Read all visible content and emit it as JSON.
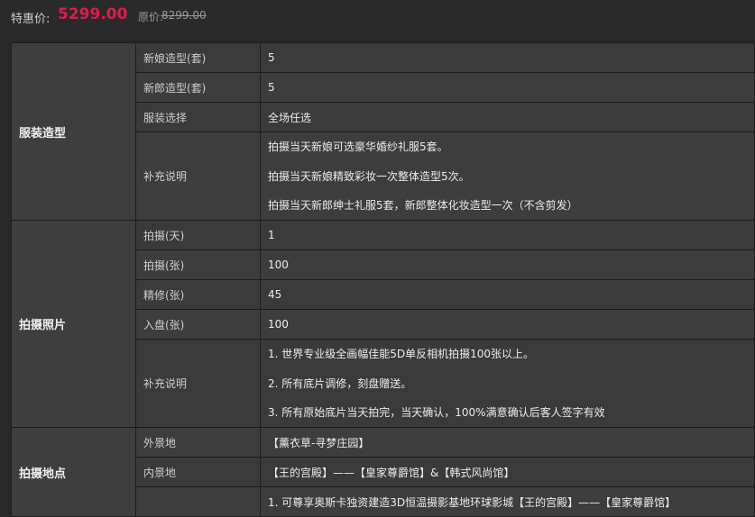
{
  "price": {
    "label": "特惠价:",
    "value": "5299.00",
    "orig_label": "原价:",
    "orig_value": "8299.00"
  },
  "sections": [
    {
      "title": "服装造型",
      "rows": [
        {
          "label": "新娘造型(套)",
          "value": "5"
        },
        {
          "label": "新郎造型(套)",
          "value": "5"
        },
        {
          "label": "服装选择",
          "value": "全场任选"
        },
        {
          "label": "补充说明",
          "lines": [
            "拍摄当天新娘可选豪华婚纱礼服5套。",
            "拍摄当天新娘精致彩妆一次整体造型5次。",
            "拍摄当天新郎绅士礼服5套，新郎整体化妆造型一次（不含剪发）"
          ]
        }
      ]
    },
    {
      "title": "拍摄照片",
      "rows": [
        {
          "label": "拍摄(天)",
          "value": "1"
        },
        {
          "label": "拍摄(张)",
          "value": "100"
        },
        {
          "label": "精修(张)",
          "value": "45"
        },
        {
          "label": "入盘(张)",
          "value": "100"
        },
        {
          "label": "补充说明",
          "lines": [
            "1. 世界专业级全画幅佳能5D单反相机拍摄100张以上。",
            "2. 所有底片调修，刻盘赠送。",
            "3. 所有原始底片当天拍完，当天确认，100%满意确认后客人签字有效"
          ]
        }
      ]
    },
    {
      "title": "拍摄地点",
      "rows": [
        {
          "label": "外景地",
          "value": "【薰衣草-寻梦庄园】"
        },
        {
          "label": "内景地",
          "value": "【王的宫殿】——【皇家尊爵馆】&【韩式风尚馆】"
        },
        {
          "label": "",
          "value": "1.  可尊享奥斯卡独资建造3D恒温摄影基地环球影城【王的宫殿】——【皇家尊爵馆】"
        }
      ]
    }
  ],
  "colors": {
    "price": "#e01a4f",
    "background": "#282828",
    "cell": "#3a3a3a"
  }
}
